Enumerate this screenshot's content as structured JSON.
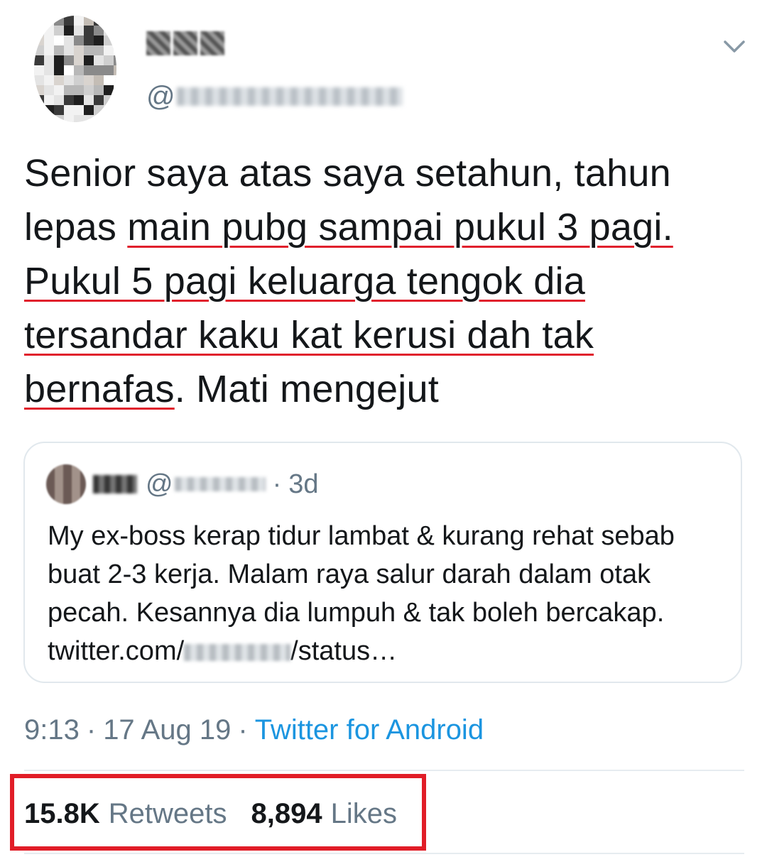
{
  "tweet": {
    "handle_prefix": "@",
    "text_segments": [
      {
        "text": "Senior saya atas saya setahun, tahun lepas ",
        "underlined": false
      },
      {
        "text": "main pubg sampai pukul 3 pagi. Pukul 5 pagi keluarga tengok dia tersandar kaku kat kerusi dah tak bernafas",
        "underlined": true
      },
      {
        "text": ". Mati mengejut",
        "underlined": false
      }
    ],
    "time": "9:13",
    "date": "17 Aug 19",
    "source": "Twitter for Android",
    "separator": "·"
  },
  "quoted_tweet": {
    "handle_prefix": "@",
    "age": "3d",
    "separator": "·",
    "text": "My ex-boss kerap tidur lambat & kurang rehat sebab buat 2-3 kerja. Malam raya salur darah dalam otak pecah. Kesannya dia lumpuh & tak boleh bercakap. ",
    "link_prefix": "twitter.com/",
    "link_suffix": "/status…"
  },
  "stats": {
    "retweets_count": "15.8K",
    "retweets_label": "Retweets",
    "likes_count": "8,894",
    "likes_label": "Likes"
  },
  "icons": {
    "menu": "chevron-down-icon"
  },
  "colors": {
    "text": "#14171a",
    "secondary": "#657786",
    "link": "#1b95e0",
    "highlight": "#e11d27",
    "underline": "#e0202c",
    "border": "#e1e8ed"
  }
}
